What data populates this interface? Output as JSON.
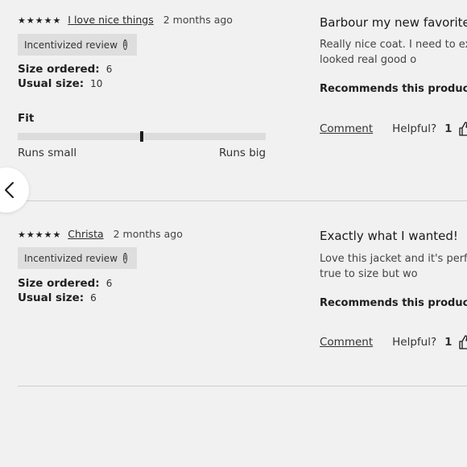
{
  "carousel": {
    "prev_icon": "chevron-left-icon"
  },
  "reviews": [
    {
      "stars": "★★★★★",
      "rating": 5,
      "author": "I love nice things",
      "date": "2 months ago",
      "badge": "Incentivized review",
      "badge_icon": "info-icon",
      "size_ordered_label": "Size ordered:",
      "size_ordered": "6",
      "usual_size_label": "Usual size:",
      "usual_size": "10",
      "fit": {
        "label": "Fit",
        "min_label": "Runs small",
        "max_label": "Runs big",
        "value": 0.5
      },
      "title": "Barbour my new favorite",
      "body": "Really nice coat. I need to ex weight. It looked real good o",
      "recommends": "Recommends this product",
      "comment_label": "Comment",
      "helpful_label": "Helpful?",
      "helpful_count": "1",
      "helpful_icon": "thumbs-up-icon"
    },
    {
      "stars": "★★★★★",
      "rating": 5,
      "author": "Christa",
      "date": "2 months ago",
      "badge": "Incentivized review",
      "badge_icon": "info-icon",
      "size_ordered_label": "Size ordered:",
      "size_ordered": "6",
      "usual_size_label": "Usual size:",
      "usual_size": "6",
      "title": "Exactly what I wanted!",
      "body": "Love this jacket and it's perfe and it fits true to size but wo",
      "recommends": "Recommends this product",
      "comment_label": "Comment",
      "helpful_label": "Helpful?",
      "helpful_count": "1",
      "helpful_icon": "thumbs-up-icon"
    }
  ]
}
